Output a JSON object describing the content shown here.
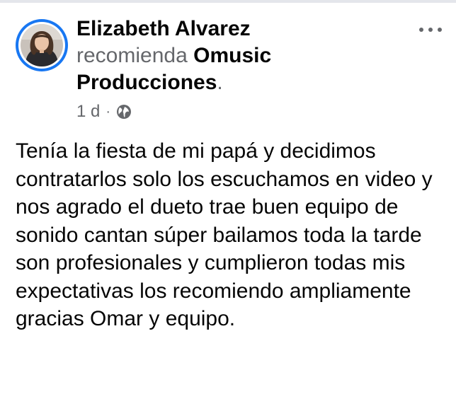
{
  "post": {
    "author": "Elizabeth Alvarez",
    "action": "recomienda",
    "page": "Omusic Producciones",
    "period": ".",
    "time": "1 d",
    "separator": "·",
    "privacy_icon": "globe-icon",
    "more_icon": "more-options-icon",
    "text": "Tenía la fiesta de mi papá y decidimos contratarlos solo los escuchamos en video y nos agrado el dueto trae buen equipo de sonido cantan súper bailamos toda la tarde son profesionales y cumplieron todas mis expectativas los recomiendo ampliamente gracias Omar y equipo."
  },
  "colors": {
    "accent": "#1877f2",
    "secondary_text": "#65676b",
    "primary_text": "#050505"
  }
}
